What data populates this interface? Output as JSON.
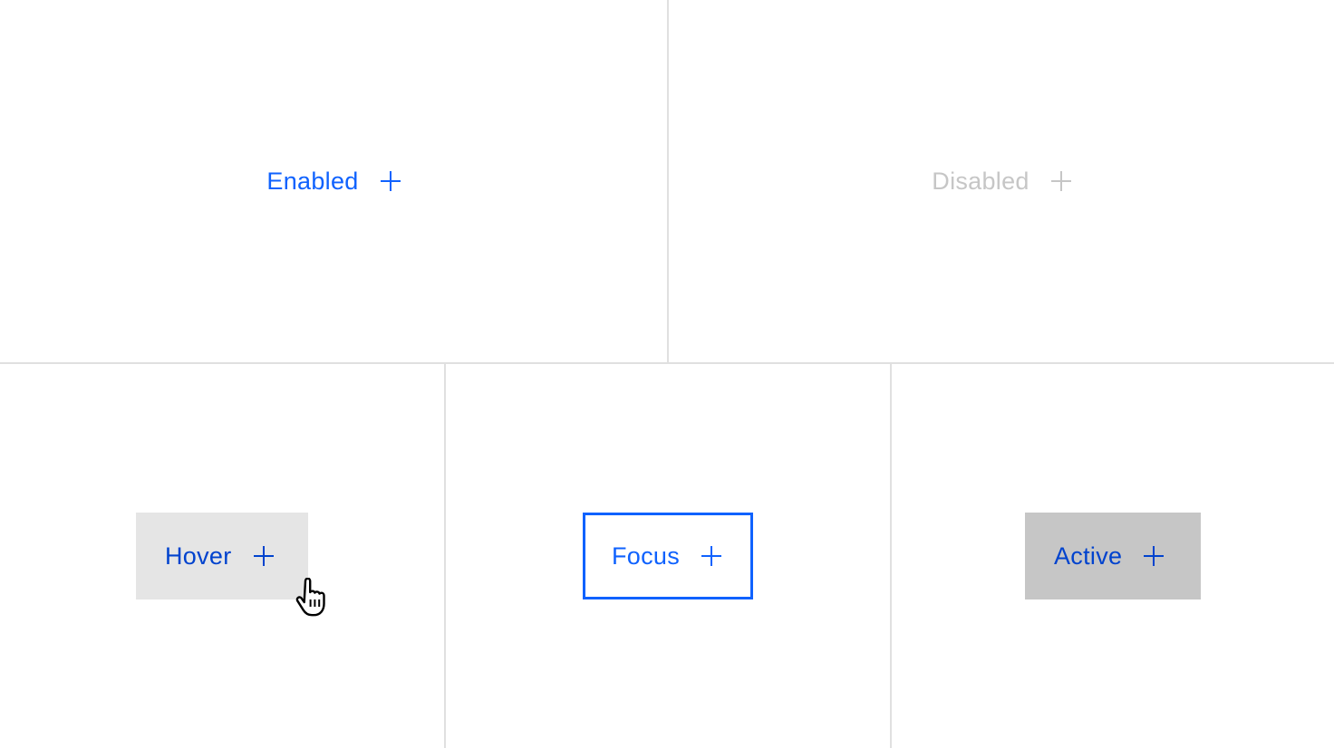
{
  "states": {
    "enabled": {
      "label": "Enabled",
      "icon": "plus-icon"
    },
    "disabled": {
      "label": "Disabled",
      "icon": "plus-icon"
    },
    "hover": {
      "label": "Hover",
      "icon": "plus-icon"
    },
    "focus": {
      "label": "Focus",
      "icon": "plus-icon"
    },
    "active": {
      "label": "Active",
      "icon": "plus-icon"
    }
  },
  "colors": {
    "primary": "#0f62fe",
    "primary_pressed": "#0043ce",
    "disabled_text": "#c6c6c6",
    "hover_bg": "#e5e5e5",
    "active_bg": "#c6c6c6",
    "divider": "#e0e0e0"
  },
  "cursor": {
    "icon": "hand-pointer-icon"
  }
}
